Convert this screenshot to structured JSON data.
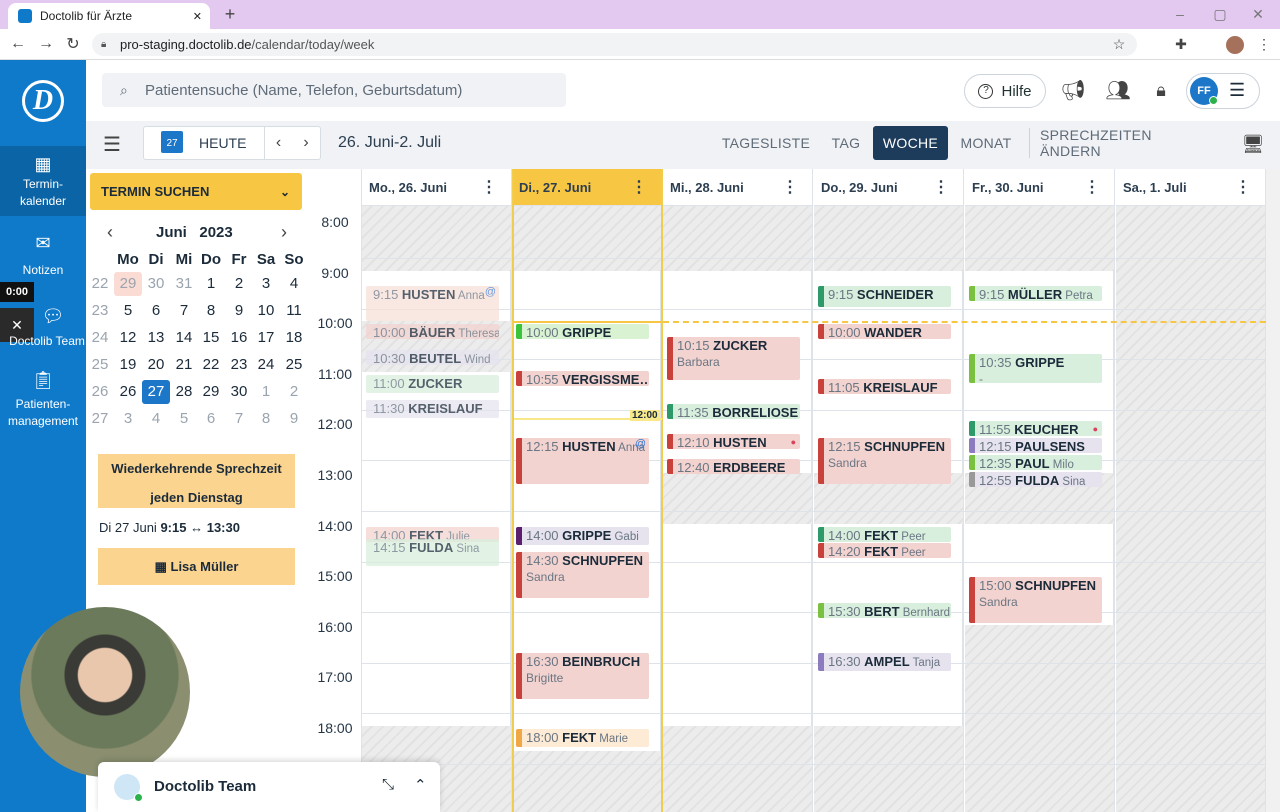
{
  "browser": {
    "tab_title": "Doctolib für Ärzte",
    "url_host": "pro-staging.doctolib.de",
    "url_path": "/calendar/today/week",
    "new_tab": "+",
    "close": "✕"
  },
  "sidebar": {
    "items": [
      {
        "label1": "Termin-",
        "label2": "kalender",
        "icon": "calendar-icon"
      },
      {
        "label1": "Notizen",
        "icon": "mail-icon"
      },
      {
        "label1": "Doctolib Team",
        "icon": "chat-icon"
      },
      {
        "label1": "Patienten-",
        "label2": "management",
        "icon": "clipboard-icon"
      }
    ],
    "timer": "0:00"
  },
  "header": {
    "search_placeholder": "Patientensuche (Name, Telefon, Geburtsdatum)",
    "help": "Hilfe",
    "avatar": "FF"
  },
  "toolbar": {
    "today_day": "27",
    "today": "HEUTE",
    "range": "26. Juni-2. Juli",
    "views": [
      "TAGESLISTE",
      "TAG",
      "WOCHE",
      "MONAT"
    ],
    "active_view": "WOCHE",
    "hours": "SPRECHZEITEN ÄNDERN"
  },
  "finder": {
    "label": "TERMIN SUCHEN"
  },
  "minical": {
    "month": "Juni",
    "year": "2023",
    "weekdays": [
      "Mo",
      "Di",
      "Mi",
      "Do",
      "Fr",
      "Sa",
      "So"
    ],
    "weeks": [
      [
        "22",
        "29",
        "30",
        "31",
        "1",
        "2",
        "3",
        "4"
      ],
      [
        "23",
        "5",
        "6",
        "7",
        "8",
        "9",
        "10",
        "11"
      ],
      [
        "24",
        "12",
        "13",
        "14",
        "15",
        "16",
        "17",
        "18"
      ],
      [
        "25",
        "19",
        "20",
        "21",
        "22",
        "23",
        "24",
        "25"
      ],
      [
        "26",
        "26",
        "27",
        "28",
        "29",
        "30",
        "1",
        "2"
      ],
      [
        "27",
        "3",
        "4",
        "5",
        "6",
        "7",
        "8",
        "9"
      ]
    ]
  },
  "recurring": {
    "line1": "Wiederkehrende Sprechzeit",
    "line2": "jeden Dienstag",
    "date": "Di 27 Juni",
    "from": "9:15",
    "arrow": "↔",
    "to": "13:30",
    "person": "Lisa Müller"
  },
  "chat": {
    "title": "Doctolib Team"
  },
  "days": [
    "Mo., 26. Juni",
    "Di., 27. Juni",
    "Mi., 28. Juni",
    "Do., 29. Juni",
    "Fr., 30. Juni",
    "Sa., 1. Juli"
  ],
  "hours": [
    "8:00",
    "9:00",
    "10:00",
    "11:00",
    "12:00",
    "13:00",
    "14:00",
    "15:00",
    "16:00",
    "17:00",
    "18:00"
  ],
  "now_label": "12:00",
  "events": [
    {
      "d": 0,
      "s": "9:15",
      "dur": 45,
      "t": "HUSTEN",
      "n": "Anna",
      "c": "#f8dfd8",
      "bar": "",
      "past": true,
      "at": true
    },
    {
      "d": 0,
      "s": "10:00",
      "dur": 18,
      "t": "BÄUER",
      "n": "Theresa",
      "c": "#f3d3d0",
      "bar": "",
      "past": true
    },
    {
      "d": 0,
      "s": "10:30",
      "dur": 18,
      "t": "BEUTEL",
      "n": "Wind",
      "c": "#e6e3ef",
      "bar": "",
      "past": true
    },
    {
      "d": 0,
      "s": "11:00",
      "dur": 25,
      "t": "ZUCKER",
      "n": "",
      "c": "#d9efdd",
      "bar": "",
      "past": true
    },
    {
      "d": 0,
      "s": "11:30",
      "dur": 25,
      "t": "KREISLAUF",
      "n": "",
      "c": "#e6e3ef",
      "bar": "",
      "past": true
    },
    {
      "d": 0,
      "s": "14:00",
      "dur": 15,
      "t": "FEKT",
      "n": "Julie",
      "c": "#f3d3d0",
      "bar": "",
      "past": true
    },
    {
      "d": 0,
      "s": "14:15",
      "dur": 35,
      "t": "FULDA",
      "n": "Sina",
      "c": "#d9efdd",
      "bar": "",
      "past": true
    },
    {
      "d": 1,
      "s": "10:00",
      "dur": 15,
      "t": "GRIPPE",
      "n": "",
      "c": "#d9f2d2",
      "bar": "#3cc33c"
    },
    {
      "d": 1,
      "s": "10:55",
      "dur": 20,
      "t": "VERGISSME…",
      "n": "",
      "c": "#f3d3d0",
      "bar": "#c8413a"
    },
    {
      "d": 1,
      "s": "12:15",
      "dur": 58,
      "t": "HUSTEN",
      "n": "Anna",
      "c": "#f3d3d0",
      "bar": "#c8413a",
      "at": true
    },
    {
      "d": 1,
      "s": "14:00",
      "dur": 25,
      "t": "GRIPPE",
      "n": "Gabi",
      "c": "#e6e3ef",
      "bar": "#5b1f6b"
    },
    {
      "d": 1,
      "s": "14:30",
      "dur": 58,
      "t": "SCHNUPFEN",
      "n": "Sandra",
      "c": "#f3d3d0",
      "bar": "#c8413a",
      "two": true
    },
    {
      "d": 1,
      "s": "16:30",
      "dur": 58,
      "t": "BEINBRUCH",
      "n": "Brigitte",
      "c": "#f3d3d0",
      "bar": "#c8413a",
      "two": true
    },
    {
      "d": 1,
      "s": "18:00",
      "dur": 25,
      "t": "FEKT",
      "n": "Marie",
      "c": "#fdebd5",
      "bar": "#f0a844"
    },
    {
      "d": 2,
      "s": "10:15",
      "dur": 55,
      "t": "ZUCKER",
      "n": "Barbara",
      "c": "#f3d3d0",
      "bar": "#c8413a",
      "two": true
    },
    {
      "d": 2,
      "s": "11:35",
      "dur": 18,
      "t": "BORRELIOSE",
      "n": "",
      "c": "#d9efdd",
      "bar": "#2e9a6a"
    },
    {
      "d": 2,
      "s": "12:10",
      "dur": 15,
      "t": "HUSTEN",
      "n": "",
      "c": "#f3d3d0",
      "bar": "#c8413a",
      "person": true
    },
    {
      "d": 2,
      "s": "12:40",
      "dur": 15,
      "t": "ERDBEERE",
      "n": "",
      "c": "#f3d3d0",
      "bar": "#c8413a"
    },
    {
      "d": 3,
      "s": "9:15",
      "dur": 28,
      "t": "SCHNEIDER",
      "n": "",
      "c": "#d9efdd",
      "bar": "#2e9a6a"
    },
    {
      "d": 3,
      "s": "10:00",
      "dur": 15,
      "t": "WANDER",
      "n": "",
      "c": "#f3d3d0",
      "bar": "#c8413a"
    },
    {
      "d": 3,
      "s": "11:05",
      "dur": 18,
      "t": "KREISLAUF",
      "n": "",
      "c": "#f3d3d0",
      "bar": "#c8413a"
    },
    {
      "d": 3,
      "s": "12:15",
      "dur": 58,
      "t": "SCHNUPFEN",
      "n": "Sandra",
      "c": "#f3d3d0",
      "bar": "#c8413a",
      "two": true
    },
    {
      "d": 3,
      "s": "14:00",
      "dur": 18,
      "t": "FEKT",
      "n": "Peer",
      "c": "#d9efdd",
      "bar": "#2e9a6a"
    },
    {
      "d": 3,
      "s": "14:20",
      "dur": 15,
      "t": "FEKT",
      "n": "Peer",
      "c": "#f3d3d0",
      "bar": "#c8413a"
    },
    {
      "d": 3,
      "s": "15:30",
      "dur": 20,
      "t": "BERT",
      "n": "Bernhard",
      "c": "#d9efdd",
      "bar": "#7ac142"
    },
    {
      "d": 3,
      "s": "16:30",
      "dur": 25,
      "t": "AMPEL",
      "n": "Tanja",
      "c": "#e6e3ef",
      "bar": "#8d7bc0"
    },
    {
      "d": 4,
      "s": "9:15",
      "dur": 18,
      "t": "MÜLLER",
      "n": "Petra",
      "c": "#d9efdd",
      "bar": "#7ac142"
    },
    {
      "d": 4,
      "s": "10:35",
      "dur": 38,
      "t": "GRIPPE",
      "n": "-",
      "c": "#d9efdd",
      "bar": "#7ac142",
      "two": true
    },
    {
      "d": 4,
      "s": "11:55",
      "dur": 15,
      "t": "KEUCHER",
      "n": "",
      "c": "#d9efdd",
      "bar": "#2e9a6a",
      "person": true
    },
    {
      "d": 4,
      "s": "12:15",
      "dur": 15,
      "t": "PAULSENS",
      "n": "",
      "c": "#e6e3ef",
      "bar": "#8d7bc0"
    },
    {
      "d": 4,
      "s": "12:35",
      "dur": 15,
      "t": "PAUL",
      "n": "Milo",
      "c": "#d9efdd",
      "bar": "#7ac142"
    },
    {
      "d": 4,
      "s": "12:55",
      "dur": 15,
      "t": "FULDA",
      "n": "Sina",
      "c": "#e6e3ef",
      "bar": "#999"
    },
    {
      "d": 4,
      "s": "15:00",
      "dur": 58,
      "t": "SCHNUPFEN",
      "n": "Sandra",
      "c": "#f3d3d0",
      "bar": "#c8413a",
      "two": true
    }
  ]
}
